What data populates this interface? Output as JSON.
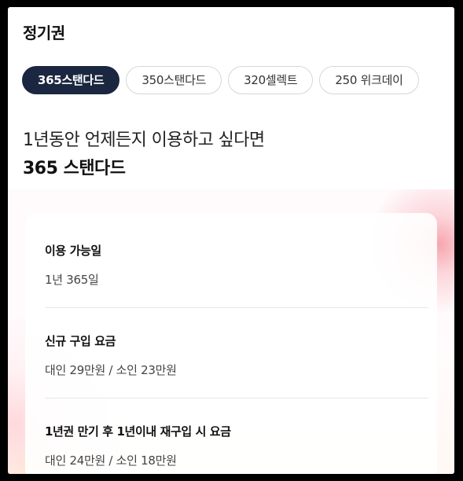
{
  "page": {
    "title": "정기권"
  },
  "tabs": [
    {
      "label": "365스탠다드",
      "active": true
    },
    {
      "label": "350스탠다드",
      "active": false
    },
    {
      "label": "320셀렉트",
      "active": false
    },
    {
      "label": "250 위크데이",
      "active": false
    }
  ],
  "hero": {
    "subtitle": "1년동안 언제든지 이용하고 싶다면",
    "title": "365 스탠다드"
  },
  "details": [
    {
      "label": "이용 가능일",
      "value": "1년 365일"
    },
    {
      "label": "신규 구입 요금",
      "value": "대인 29만원 / 소인 23만원"
    },
    {
      "label": "1년권 만기 후 1년이내 재구입 시 요금",
      "value": "대인 24만원 / 소인 18만원"
    }
  ],
  "colors": {
    "active_chip_bg": "#1b2740",
    "accent_glow": "#f696a0"
  }
}
